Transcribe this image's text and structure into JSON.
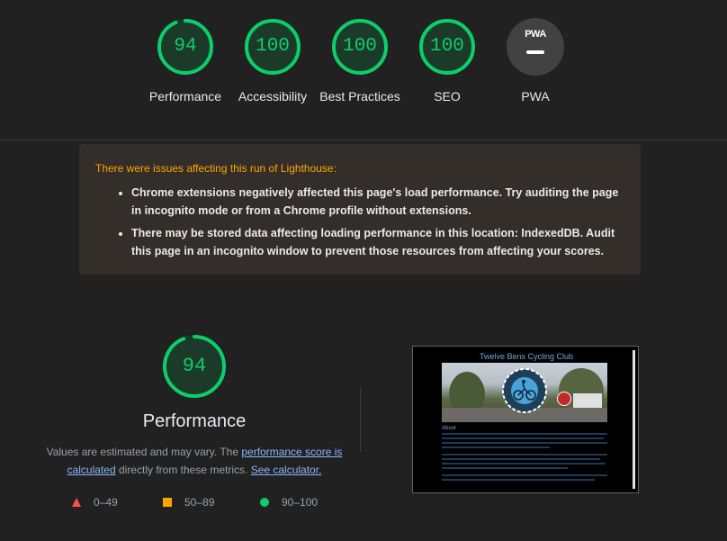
{
  "colors": {
    "pass": "#0cce6b",
    "average": "#ffa400",
    "fail": "#ff4e42",
    "gauge_track": "#0f3c26",
    "pwa_background": "#424242",
    "link": "#8ab4f8"
  },
  "gauges": [
    {
      "score": "94",
      "label": "Performance",
      "value": 0.94
    },
    {
      "score": "100",
      "label": "Accessibility",
      "value": 1.0
    },
    {
      "score": "100",
      "label": "Best Practices",
      "value": 1.0
    },
    {
      "score": "100",
      "label": "SEO",
      "value": 1.0
    }
  ],
  "pwa": {
    "badge_text": "PWA",
    "label": "PWA",
    "icon": "dash-icon"
  },
  "warnings": {
    "title": "There were issues affecting this run of Lighthouse:",
    "items": [
      "Chrome extensions negatively affected this page's load performance. Try auditing the page in incognito mode or from a Chrome profile without extensions.",
      "There may be stored data affecting loading performance in this location: IndexedDB. Audit this page in an incognito window to prevent those resources from affecting your scores."
    ]
  },
  "performance": {
    "score": "94",
    "value": 0.94,
    "title": "Performance",
    "desc_prefix": "Values are estimated and may vary. The ",
    "desc_link1": "performance score is calculated",
    "desc_middle": " directly from these metrics. ",
    "desc_link2": "See calculator."
  },
  "legend": [
    {
      "shape": "triangle-icon",
      "range": "0–49"
    },
    {
      "shape": "square-icon",
      "range": "50–89"
    },
    {
      "shape": "circle-icon",
      "range": "90–100"
    }
  ],
  "screenshot": {
    "site_title": "Twelve Bens Cycling Club",
    "heading": "About"
  }
}
